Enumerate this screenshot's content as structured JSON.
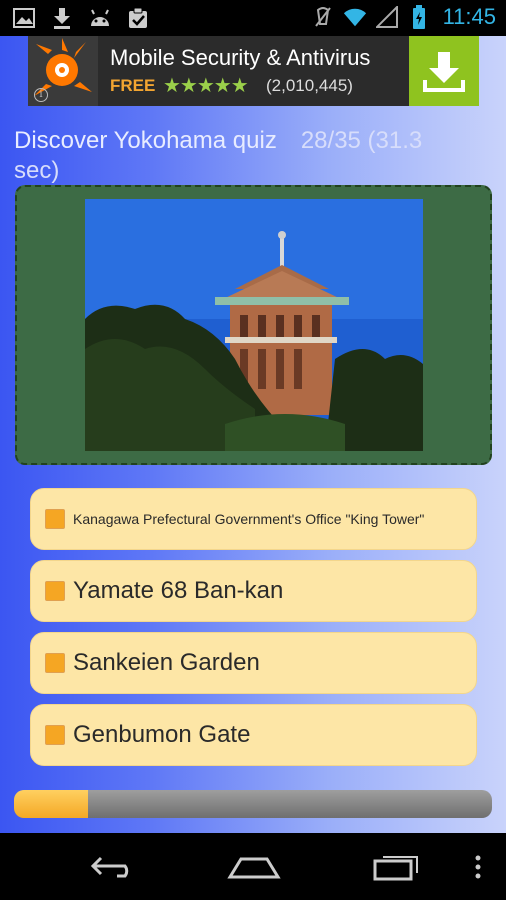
{
  "status_bar": {
    "time": "11:45",
    "icons": [
      "gallery-icon",
      "download-icon",
      "android-icon",
      "clipboard-icon",
      "mute-icon",
      "wifi-icon",
      "signal-icon",
      "battery-icon"
    ]
  },
  "ad": {
    "title": "Mobile Security & Antivirus",
    "price": "FREE",
    "stars": "★★★★★",
    "rating": 4.5,
    "count": "(2,010,445)",
    "info_glyph": "i"
  },
  "quiz": {
    "title": "Discover Yokohama quiz",
    "progress_text": "28/35 (31.3 sec)"
  },
  "answers": [
    {
      "label": "Kanagawa Prefectural Government's Office \"King Tower\""
    },
    {
      "label": "Yamate 68 Ban-kan"
    },
    {
      "label": "Sankeien Garden"
    },
    {
      "label": "Genbumon Gate"
    }
  ],
  "progress_bar": {
    "fraction": 0.155
  },
  "colors": {
    "accent": "#f5a623",
    "answer_bg": "#fde6a6",
    "frame_bg": "#3d6b45",
    "ad_download": "#8fc31f",
    "clock": "#33b5e5"
  }
}
